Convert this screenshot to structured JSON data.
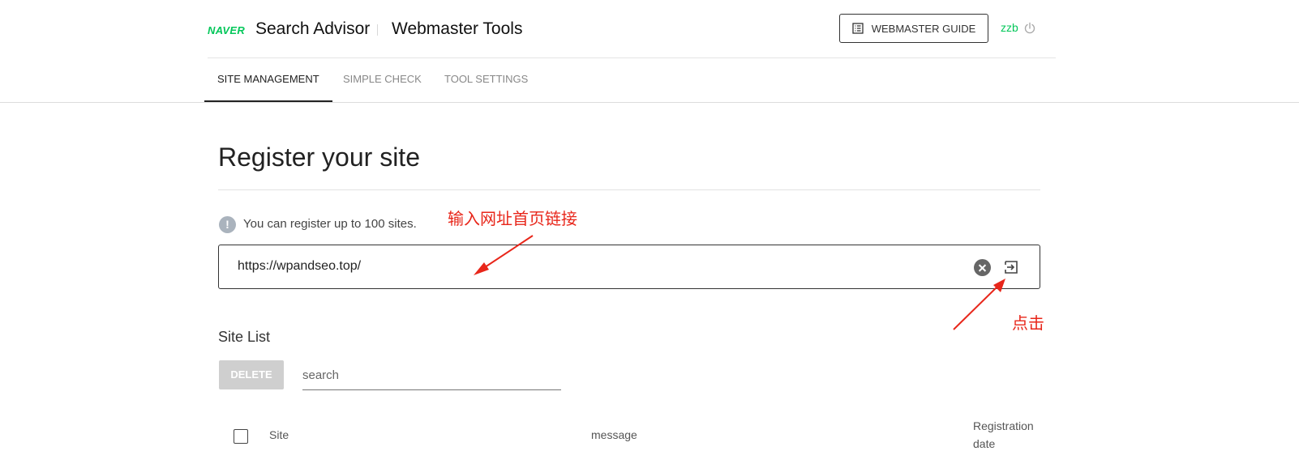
{
  "header": {
    "logo": "NAVER",
    "brand": "Search Advisor",
    "product": "Webmaster Tools",
    "guide_button": "WEBMASTER GUIDE",
    "user": "zzb"
  },
  "tabs": [
    {
      "label": "SITE MANAGEMENT",
      "active": true
    },
    {
      "label": "SIMPLE CHECK",
      "active": false
    },
    {
      "label": "TOOL SETTINGS",
      "active": false
    }
  ],
  "main": {
    "title": "Register your site",
    "info": "You can register up to 100 sites.",
    "url_value": "https://wpandseo.top/"
  },
  "annotations": {
    "input_hint": "输入网址首页链接",
    "click_hint": "点击",
    "color": "#e8261a"
  },
  "site_list": {
    "title": "Site List",
    "delete_label": "DELETE",
    "search_placeholder": "search",
    "columns": {
      "site": "Site",
      "message": "message",
      "registration_line1": "Registration",
      "registration_line2": "date"
    }
  },
  "colors": {
    "accent": "#03c75a",
    "disabled_button": "#cfcfcf"
  }
}
